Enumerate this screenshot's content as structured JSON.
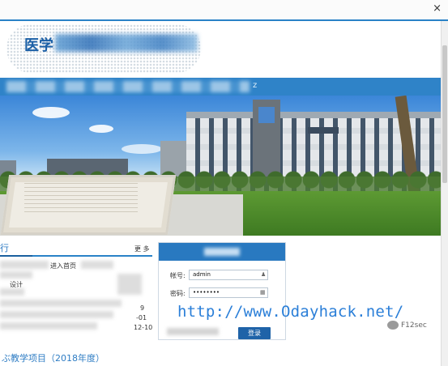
{
  "window": {
    "close_glyph": "×"
  },
  "header": {
    "logo_prefix": "医学",
    "nav_trailing": "z"
  },
  "news": {
    "title_fragment": "行",
    "more_label": "更 多",
    "snippets": [
      "进入首页",
      "-01",
      "12-10",
      "9",
      "设计"
    ]
  },
  "login": {
    "username_label": "帐号:",
    "username_value": "admin",
    "password_label": "密码:",
    "password_value": "••••••••",
    "submit_label": "登录"
  },
  "bottom": {
    "project_link": "ぶ教学项目（2018年度）"
  },
  "overlay": {
    "watermark_url": "http://www.Odayhack.net/",
    "badge_text": "F12sec"
  },
  "colors": {
    "accent": "#2f83c8",
    "button": "#1f63a8",
    "watermark": "#2b7fd8"
  },
  "icons": {
    "user_field": "user-icon",
    "password_field": "keyboard-icon",
    "close": "close-icon",
    "badge": "wechat-icon"
  }
}
